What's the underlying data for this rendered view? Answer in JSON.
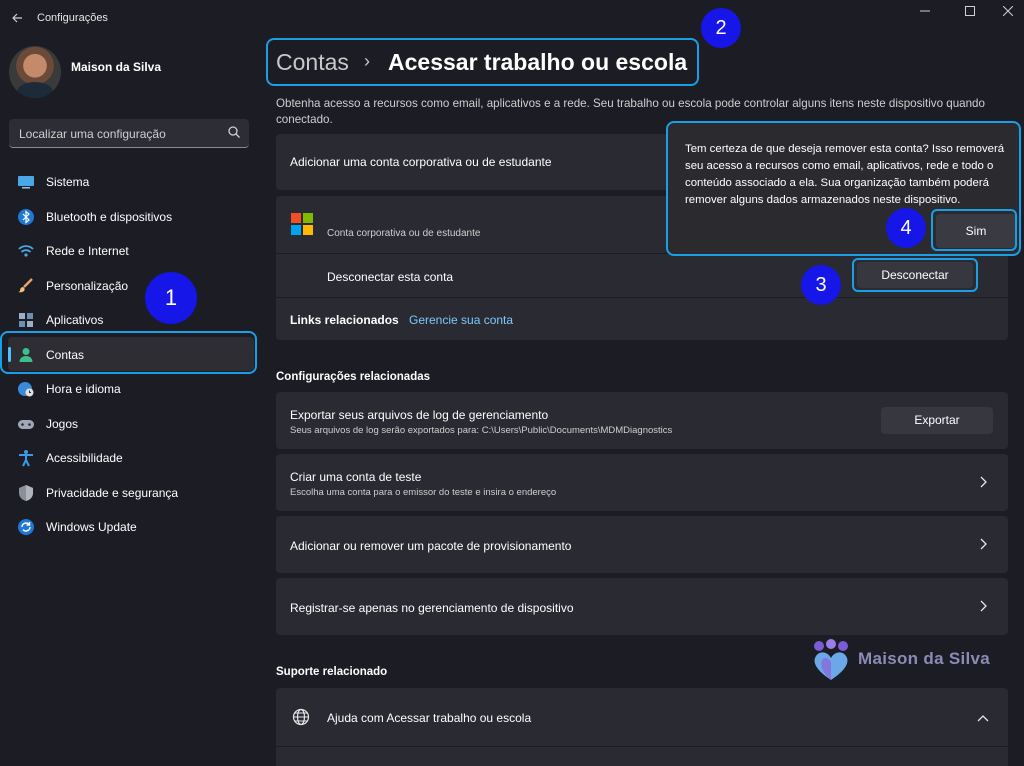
{
  "window": {
    "title": "Configurações"
  },
  "user": {
    "name": "Maison da Silva"
  },
  "search": {
    "placeholder": "Localizar uma configuração"
  },
  "sidebar": {
    "items": [
      {
        "label": "Sistema",
        "icon": "monitor-icon"
      },
      {
        "label": "Bluetooth e dispositivos",
        "icon": "bluetooth-icon"
      },
      {
        "label": "Rede e Internet",
        "icon": "wifi-icon"
      },
      {
        "label": "Personalização",
        "icon": "brush-icon"
      },
      {
        "label": "Aplicativos",
        "icon": "apps-icon"
      },
      {
        "label": "Contas",
        "icon": "person-icon",
        "active": true
      },
      {
        "label": "Hora e idioma",
        "icon": "globe-clock-icon"
      },
      {
        "label": "Jogos",
        "icon": "gamepad-icon"
      },
      {
        "label": "Acessibilidade",
        "icon": "accessibility-icon"
      },
      {
        "label": "Privacidade e segurança",
        "icon": "shield-icon"
      },
      {
        "label": "Windows Update",
        "icon": "update-icon"
      }
    ]
  },
  "breadcrumb": {
    "parent": "Contas",
    "separator": "›",
    "current": "Acessar trabalho ou escola"
  },
  "description": "Obtenha acesso a recursos como email, aplicativos e a rede. Seu trabalho ou escola pode controlar alguns itens neste dispositivo quando conectado.",
  "add_account": {
    "label": "Adicionar uma conta corporativa ou de estudante"
  },
  "account": {
    "type_label": "Conta corporativa ou de estudante",
    "disconnect_label": "Desconectar esta conta",
    "disconnect_button": "Desconectar"
  },
  "related_links": {
    "label": "Links relacionados",
    "manage_link": "Gerencie sua conta"
  },
  "related_settings": {
    "title": "Configurações relacionadas",
    "items": [
      {
        "title": "Exportar seus arquivos de log de gerenciamento",
        "subtitle": "Seus arquivos de log serão exportados para: C:\\Users\\Public\\Documents\\MDMDiagnostics",
        "button": "Exportar"
      },
      {
        "title": "Criar uma conta de teste",
        "subtitle": "Escolha uma conta para o emissor do teste e insira o endereço"
      },
      {
        "title": "Adicionar ou remover um pacote de provisionamento"
      },
      {
        "title": "Registrar-se apenas no gerenciamento de dispositivo"
      }
    ]
  },
  "related_support": {
    "title": "Suporte relacionado",
    "help_item": "Ajuda com Acessar trabalho ou escola"
  },
  "flyout": {
    "message": "Tem certeza de que deseja remover esta conta? Isso removerá seu acesso a recursos como email, aplicativos, rede e todo o conteúdo associado a ela. Sua organização também poderá remover alguns dados armazenados neste dispositivo.",
    "confirm_button": "Sim"
  },
  "annotations": {
    "step1": "1",
    "step2": "2",
    "step3": "3",
    "step4": "4"
  },
  "watermark": {
    "text": "Maison da Silva"
  },
  "colors": {
    "accent": "#4cc2ff",
    "highlight": "#1a9ee6",
    "badge": "#1616e8",
    "link": "#7fc8ff"
  }
}
